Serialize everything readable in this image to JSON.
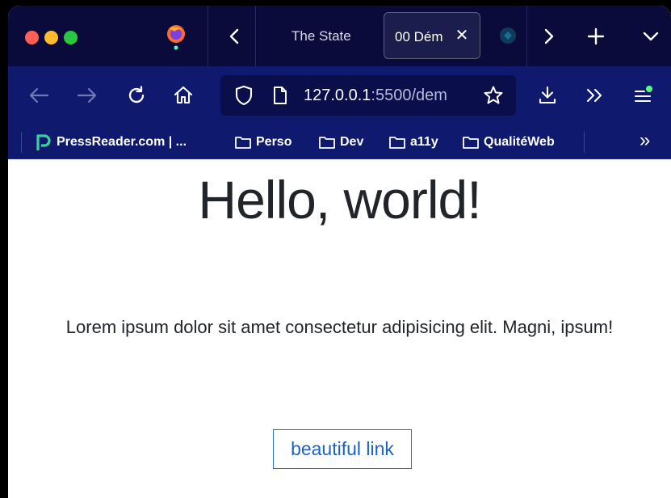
{
  "window": {
    "controls": [
      "close",
      "minimize",
      "zoom"
    ],
    "colors": {
      "close": "#ff5f57",
      "minimize": "#febc2e",
      "zoom": "#28c840"
    }
  },
  "tabs": {
    "items": [
      {
        "label": "The State",
        "active": false
      },
      {
        "label": "00 Dém",
        "active": true
      }
    ],
    "close_glyph": "✕",
    "icons": [
      "firefox-icon",
      "tab-scroll-left-icon",
      "tab-favicon-icon",
      "tab-scroll-right-icon",
      "new-tab-icon",
      "tab-list-icon"
    ]
  },
  "navigation": {
    "url_host": "127.0.0.1",
    "url_rest": ":5500/dem",
    "icons": [
      "back-icon",
      "forward-icon",
      "reload-icon",
      "home-icon",
      "shield-icon",
      "page-icon",
      "bookmark-star-icon",
      "downloads-icon",
      "more-tools-icon",
      "app-menu-icon"
    ]
  },
  "bookmarks": {
    "items": [
      {
        "label": "PressReader.com | ...",
        "icon": "pressreader-icon"
      },
      {
        "label": "Perso",
        "icon": "folder-icon"
      },
      {
        "label": "Dev",
        "icon": "folder-icon"
      },
      {
        "label": "a11y",
        "icon": "folder-icon"
      },
      {
        "label": "QualitéWeb",
        "icon": "folder-icon"
      }
    ],
    "overflow_glyph": "»"
  },
  "page": {
    "heading": "Hello, world!",
    "paragraph": "Lorem ipsum dolor sit amet consectetur adipisicing elit. Magni, ipsum!",
    "link_label": "beautiful link"
  },
  "colors": {
    "tab_strip_bg": "#0a0b3a",
    "toolbar_bg": "#0f1a6e",
    "link": "#1a63c9",
    "text": "#212529"
  }
}
